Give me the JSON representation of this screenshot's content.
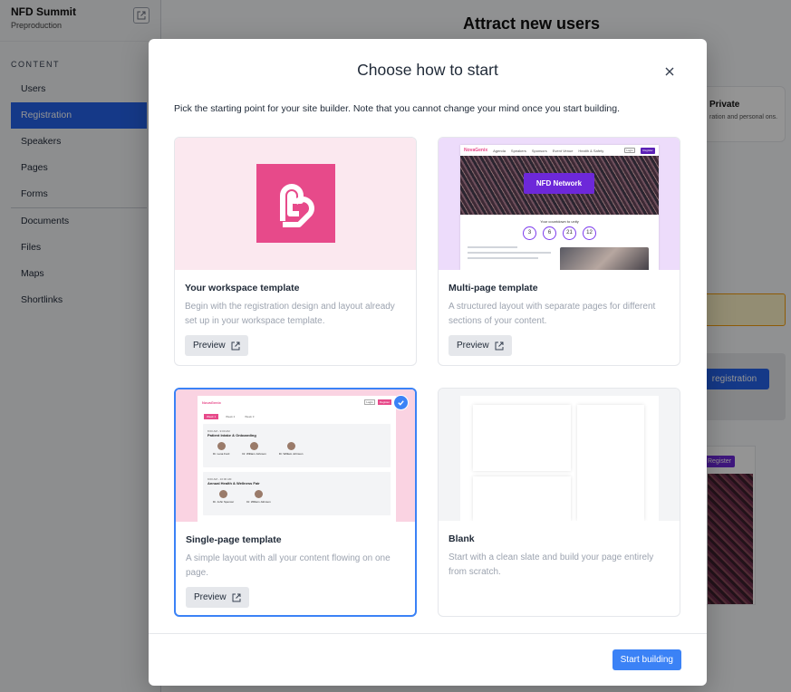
{
  "app": {
    "workspace_name": "NFD Summit",
    "workspace_stage": "Preproduction",
    "section_label": "CONTENT",
    "nav": [
      {
        "label": "Users"
      },
      {
        "label": "Registration"
      },
      {
        "label": "Speakers"
      },
      {
        "label": "Pages"
      },
      {
        "label": "Forms"
      },
      {
        "label": "Documents"
      },
      {
        "label": "Files"
      },
      {
        "label": "Maps"
      },
      {
        "label": "Shortlinks"
      }
    ],
    "active_nav": "Registration"
  },
  "background": {
    "heading": "Attract new users",
    "private_card_title": "Private",
    "private_card_desc": "ration and personal ons.",
    "registration_button": "registration",
    "preview_register": "Register"
  },
  "modal": {
    "title": "Choose how to start",
    "description": "Pick the starting point for your site builder. Note that you cannot change your mind once you start building.",
    "options": [
      {
        "title": "Your workspace template",
        "description": "Begin with the registration design and layout already set up in your workspace template.",
        "preview_label": "Preview",
        "selected": false
      },
      {
        "title": "Multi-page template",
        "description": "A structured layout with separate pages for different sections of your content.",
        "preview_label": "Preview",
        "selected": false
      },
      {
        "title": "Single-page template",
        "description": "A simple layout with all your content flowing on one page.",
        "preview_label": "Preview",
        "selected": true
      },
      {
        "title": "Blank",
        "description": "Start with a clean slate and build your page entirely from scratch.",
        "selected": false
      }
    ],
    "start_button": "Start building"
  },
  "thumbnails": {
    "multi_logo": "NovaGenix",
    "multi_links": [
      "Agenda",
      "Speakers",
      "Sponsors",
      "Event Venue",
      "Health & Safety"
    ],
    "multi_login": "Login",
    "multi_register": "Register",
    "multi_hero_button": "NFD Network",
    "multi_count_label": "Your countdown to unity",
    "multi_counts": [
      "3",
      "6",
      "21",
      "12"
    ],
    "single_logo": "NovaGenix",
    "single_login": "Login",
    "single_register": "Register",
    "single_tabs": [
      "Week 1",
      "Week 2",
      "Week 3"
    ],
    "single_block1_title": "Patient Intake & Onboarding",
    "single_block1_sub": "8:00 AM - 9:00 AM",
    "single_block1_people": [
      "Dr. Lena Ford",
      "Dr. William Johnson",
      "Dr. William Johnson"
    ],
    "single_block2_title": "Annual Health & Wellness Fair",
    "single_block2_sub": "9:00 AM - 10:00 AM",
    "single_block2_people": [
      "Dr. John Spencer",
      "Dr. William Johnson"
    ]
  },
  "colors": {
    "accent": "#3b82f6",
    "brand_pink": "#e74a8a",
    "brand_purple": "#6d28d9",
    "active_nav": "#2563eb"
  }
}
